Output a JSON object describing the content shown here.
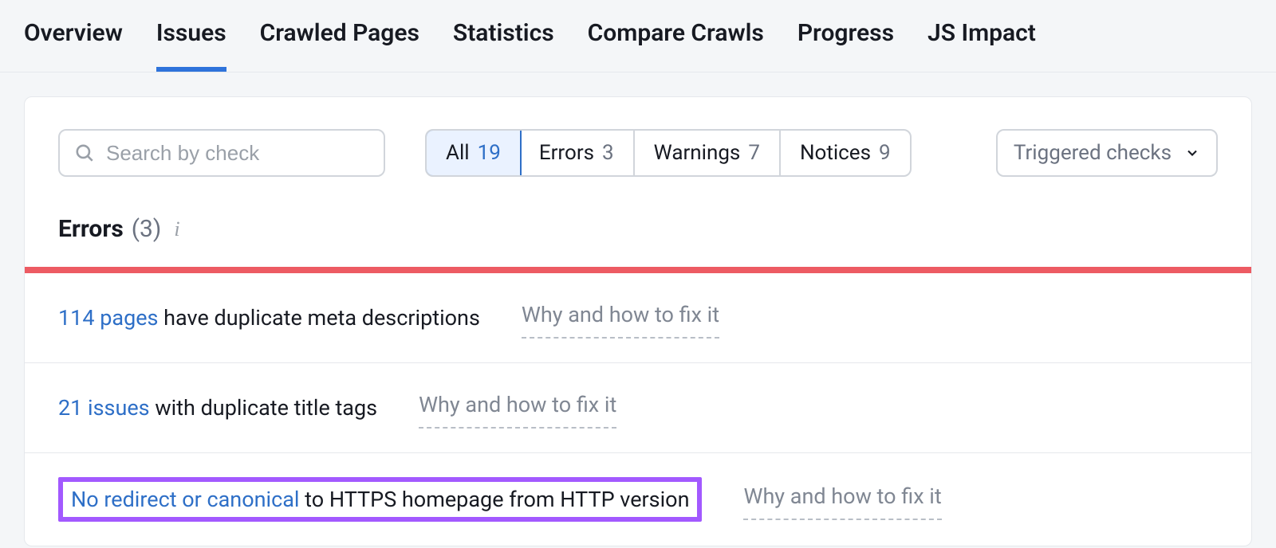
{
  "tabs": [
    {
      "label": "Overview"
    },
    {
      "label": "Issues"
    },
    {
      "label": "Crawled Pages"
    },
    {
      "label": "Statistics"
    },
    {
      "label": "Compare Crawls"
    },
    {
      "label": "Progress"
    },
    {
      "label": "JS Impact"
    }
  ],
  "active_tab": "Issues",
  "search": {
    "placeholder": "Search by check"
  },
  "filters": {
    "all": {
      "label": "All",
      "count": "19"
    },
    "errors": {
      "label": "Errors",
      "count": "3"
    },
    "warnings": {
      "label": "Warnings",
      "count": "7"
    },
    "notices": {
      "label": "Notices",
      "count": "9"
    }
  },
  "triggered_dd": "Triggered checks",
  "section": {
    "title": "Errors",
    "count": "(3)"
  },
  "why_link": "Why and how to fix it",
  "issues": {
    "row0_link": "114 pages",
    "row0_rest": " have duplicate meta descriptions",
    "row1_link": "21 issues",
    "row1_rest": " with duplicate title tags",
    "row2_link": "No redirect or canonical",
    "row2_rest": " to HTTPS homepage from HTTP version"
  }
}
